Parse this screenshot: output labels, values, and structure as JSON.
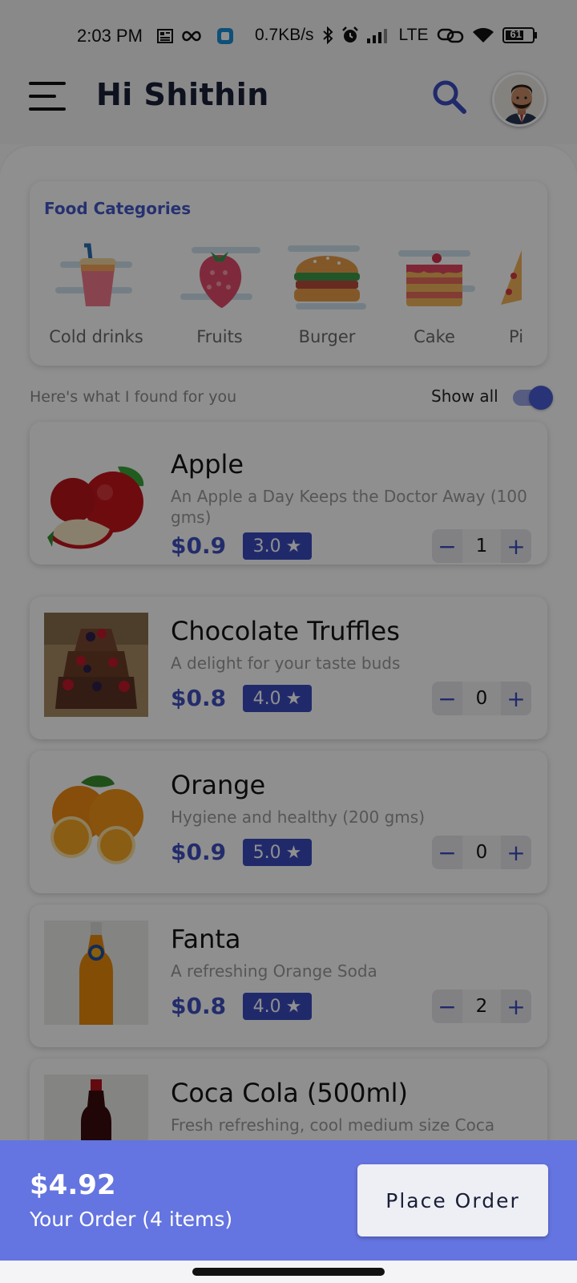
{
  "status_bar": {
    "time": "2:03 PM",
    "net_speed": "0.7KB/s",
    "network": "LTE",
    "battery": "61"
  },
  "header": {
    "greeting": "Hi Shithin",
    "icons": [
      "menu-icon",
      "search-icon",
      "avatar"
    ]
  },
  "categories": {
    "title": "Food Categories",
    "items": [
      {
        "label": "Cold drinks",
        "icon": "drink-icon"
      },
      {
        "label": "Fruits",
        "icon": "berry-icon"
      },
      {
        "label": "Burger",
        "icon": "burger-icon"
      },
      {
        "label": "Cake",
        "icon": "cake-icon"
      },
      {
        "label": "Pi",
        "icon": "pizza-icon"
      }
    ]
  },
  "results": {
    "heading": "Here's what I found for you",
    "show_all_label": "Show all",
    "show_all_on": true
  },
  "products": [
    {
      "name": "Apple",
      "desc": "An Apple a Day Keeps the Doctor Away (100 gms)",
      "price": "$0.9",
      "rating": "3.0",
      "qty": "1"
    },
    {
      "name": "Chocolate Truffles",
      "desc": "A delight for your taste buds",
      "price": "$0.8",
      "rating": "4.0",
      "qty": "0"
    },
    {
      "name": "Orange",
      "desc": "Hygiene and healthy (200 gms)",
      "price": "$0.9",
      "rating": "5.0",
      "qty": "0"
    },
    {
      "name": "Fanta",
      "desc": "A refreshing Orange Soda",
      "price": "$0.8",
      "rating": "4.0",
      "qty": "2"
    },
    {
      "name": "Coca Cola (500ml)",
      "desc": "Fresh refreshing, cool medium size Coca",
      "price": "",
      "rating": "",
      "qty": ""
    }
  ],
  "stepper": {
    "minus": "−",
    "plus": "+"
  },
  "order": {
    "total": "$4.92",
    "summary": "Your Order (4 items)",
    "button": "Place Order"
  },
  "colors": {
    "accent": "#3a4bbf",
    "order_bar": "#6474e0"
  }
}
